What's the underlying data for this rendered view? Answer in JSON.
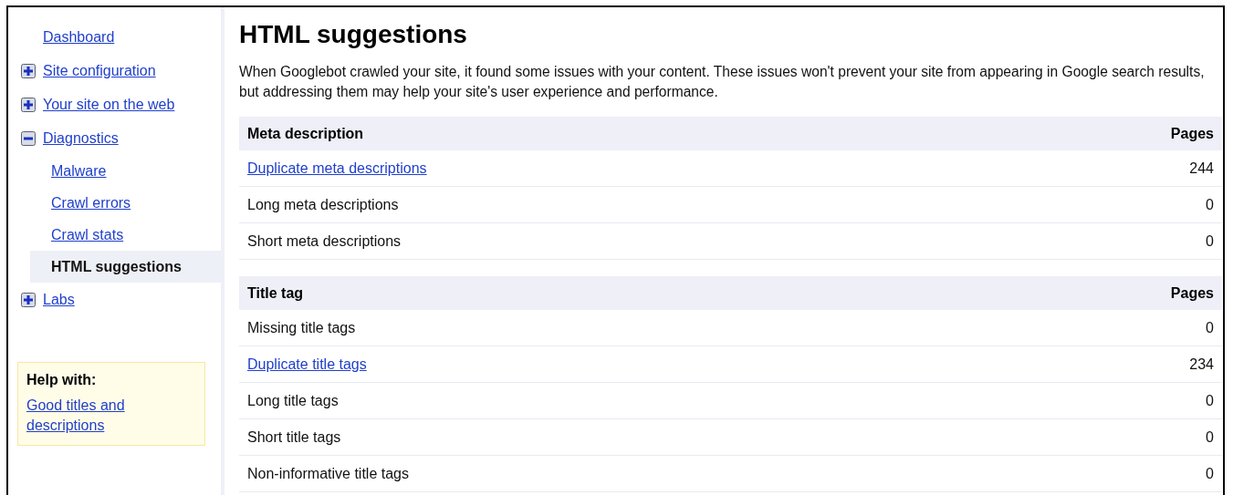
{
  "sidebar": {
    "items": [
      {
        "label": "Dashboard",
        "kind": "link",
        "selected": false
      },
      {
        "label": "Site configuration",
        "kind": "expandable",
        "expanded": false,
        "selected": false
      },
      {
        "label": "Your site on the web",
        "kind": "expandable",
        "expanded": false,
        "selected": false
      },
      {
        "label": "Diagnostics",
        "kind": "expandable",
        "expanded": true,
        "selected": false,
        "children": [
          {
            "label": "Malware",
            "selected": false
          },
          {
            "label": "Crawl errors",
            "selected": false
          },
          {
            "label": "Crawl stats",
            "selected": false
          },
          {
            "label": "HTML suggestions",
            "selected": true
          }
        ]
      },
      {
        "label": "Labs",
        "kind": "expandable",
        "expanded": false,
        "selected": false
      }
    ],
    "help": {
      "title": "Help with:",
      "link": "Good titles and descriptions"
    }
  },
  "page": {
    "title": "HTML suggestions",
    "intro": "When Googlebot crawled your site, it found some issues with your content. These issues won't prevent your site from appearing in Google search results, but addressing them may help your site's user experience and performance."
  },
  "tables": [
    {
      "columns": [
        "Meta description",
        "Pages"
      ],
      "rows": [
        {
          "label": "Duplicate meta descriptions",
          "kind": "link",
          "pages": "244"
        },
        {
          "label": "Long meta descriptions",
          "kind": "text",
          "pages": "0"
        },
        {
          "label": "Short meta descriptions",
          "kind": "text",
          "pages": "0"
        }
      ]
    },
    {
      "columns": [
        "Title tag",
        "Pages"
      ],
      "rows": [
        {
          "label": "Missing title tags",
          "kind": "text",
          "pages": "0"
        },
        {
          "label": "Duplicate title tags",
          "kind": "link",
          "pages": "234"
        },
        {
          "label": "Long title tags",
          "kind": "text",
          "pages": "0"
        },
        {
          "label": "Short title tags",
          "kind": "text",
          "pages": "0"
        },
        {
          "label": "Non-informative title tags",
          "kind": "text",
          "pages": "0"
        }
      ]
    }
  ]
}
